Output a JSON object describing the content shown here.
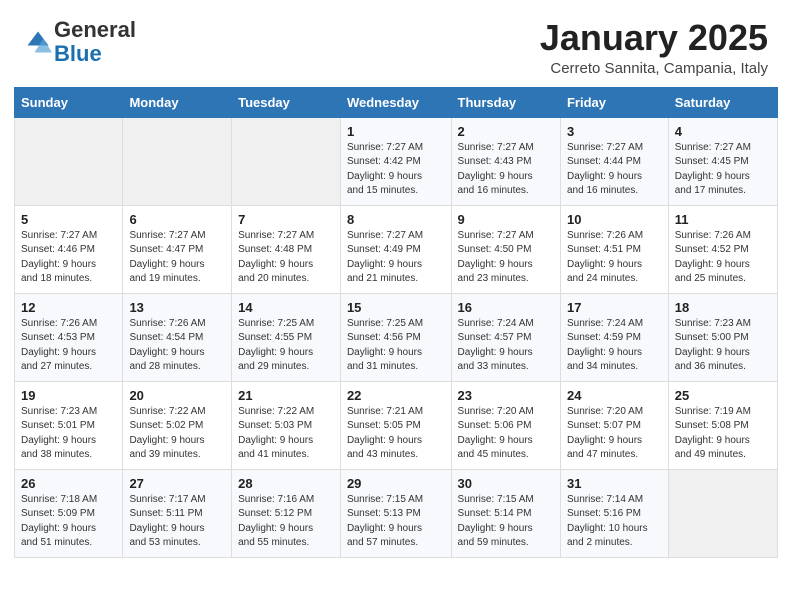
{
  "header": {
    "logo_general": "General",
    "logo_blue": "Blue",
    "month_title": "January 2025",
    "location": "Cerreto Sannita, Campania, Italy"
  },
  "weekdays": [
    "Sunday",
    "Monday",
    "Tuesday",
    "Wednesday",
    "Thursday",
    "Friday",
    "Saturday"
  ],
  "weeks": [
    [
      {
        "day": "",
        "info": ""
      },
      {
        "day": "",
        "info": ""
      },
      {
        "day": "",
        "info": ""
      },
      {
        "day": "1",
        "info": "Sunrise: 7:27 AM\nSunset: 4:42 PM\nDaylight: 9 hours\nand 15 minutes."
      },
      {
        "day": "2",
        "info": "Sunrise: 7:27 AM\nSunset: 4:43 PM\nDaylight: 9 hours\nand 16 minutes."
      },
      {
        "day": "3",
        "info": "Sunrise: 7:27 AM\nSunset: 4:44 PM\nDaylight: 9 hours\nand 16 minutes."
      },
      {
        "day": "4",
        "info": "Sunrise: 7:27 AM\nSunset: 4:45 PM\nDaylight: 9 hours\nand 17 minutes."
      }
    ],
    [
      {
        "day": "5",
        "info": "Sunrise: 7:27 AM\nSunset: 4:46 PM\nDaylight: 9 hours\nand 18 minutes."
      },
      {
        "day": "6",
        "info": "Sunrise: 7:27 AM\nSunset: 4:47 PM\nDaylight: 9 hours\nand 19 minutes."
      },
      {
        "day": "7",
        "info": "Sunrise: 7:27 AM\nSunset: 4:48 PM\nDaylight: 9 hours\nand 20 minutes."
      },
      {
        "day": "8",
        "info": "Sunrise: 7:27 AM\nSunset: 4:49 PM\nDaylight: 9 hours\nand 21 minutes."
      },
      {
        "day": "9",
        "info": "Sunrise: 7:27 AM\nSunset: 4:50 PM\nDaylight: 9 hours\nand 23 minutes."
      },
      {
        "day": "10",
        "info": "Sunrise: 7:26 AM\nSunset: 4:51 PM\nDaylight: 9 hours\nand 24 minutes."
      },
      {
        "day": "11",
        "info": "Sunrise: 7:26 AM\nSunset: 4:52 PM\nDaylight: 9 hours\nand 25 minutes."
      }
    ],
    [
      {
        "day": "12",
        "info": "Sunrise: 7:26 AM\nSunset: 4:53 PM\nDaylight: 9 hours\nand 27 minutes."
      },
      {
        "day": "13",
        "info": "Sunrise: 7:26 AM\nSunset: 4:54 PM\nDaylight: 9 hours\nand 28 minutes."
      },
      {
        "day": "14",
        "info": "Sunrise: 7:25 AM\nSunset: 4:55 PM\nDaylight: 9 hours\nand 29 minutes."
      },
      {
        "day": "15",
        "info": "Sunrise: 7:25 AM\nSunset: 4:56 PM\nDaylight: 9 hours\nand 31 minutes."
      },
      {
        "day": "16",
        "info": "Sunrise: 7:24 AM\nSunset: 4:57 PM\nDaylight: 9 hours\nand 33 minutes."
      },
      {
        "day": "17",
        "info": "Sunrise: 7:24 AM\nSunset: 4:59 PM\nDaylight: 9 hours\nand 34 minutes."
      },
      {
        "day": "18",
        "info": "Sunrise: 7:23 AM\nSunset: 5:00 PM\nDaylight: 9 hours\nand 36 minutes."
      }
    ],
    [
      {
        "day": "19",
        "info": "Sunrise: 7:23 AM\nSunset: 5:01 PM\nDaylight: 9 hours\nand 38 minutes."
      },
      {
        "day": "20",
        "info": "Sunrise: 7:22 AM\nSunset: 5:02 PM\nDaylight: 9 hours\nand 39 minutes."
      },
      {
        "day": "21",
        "info": "Sunrise: 7:22 AM\nSunset: 5:03 PM\nDaylight: 9 hours\nand 41 minutes."
      },
      {
        "day": "22",
        "info": "Sunrise: 7:21 AM\nSunset: 5:05 PM\nDaylight: 9 hours\nand 43 minutes."
      },
      {
        "day": "23",
        "info": "Sunrise: 7:20 AM\nSunset: 5:06 PM\nDaylight: 9 hours\nand 45 minutes."
      },
      {
        "day": "24",
        "info": "Sunrise: 7:20 AM\nSunset: 5:07 PM\nDaylight: 9 hours\nand 47 minutes."
      },
      {
        "day": "25",
        "info": "Sunrise: 7:19 AM\nSunset: 5:08 PM\nDaylight: 9 hours\nand 49 minutes."
      }
    ],
    [
      {
        "day": "26",
        "info": "Sunrise: 7:18 AM\nSunset: 5:09 PM\nDaylight: 9 hours\nand 51 minutes."
      },
      {
        "day": "27",
        "info": "Sunrise: 7:17 AM\nSunset: 5:11 PM\nDaylight: 9 hours\nand 53 minutes."
      },
      {
        "day": "28",
        "info": "Sunrise: 7:16 AM\nSunset: 5:12 PM\nDaylight: 9 hours\nand 55 minutes."
      },
      {
        "day": "29",
        "info": "Sunrise: 7:15 AM\nSunset: 5:13 PM\nDaylight: 9 hours\nand 57 minutes."
      },
      {
        "day": "30",
        "info": "Sunrise: 7:15 AM\nSunset: 5:14 PM\nDaylight: 9 hours\nand 59 minutes."
      },
      {
        "day": "31",
        "info": "Sunrise: 7:14 AM\nSunset: 5:16 PM\nDaylight: 10 hours\nand 2 minutes."
      },
      {
        "day": "",
        "info": ""
      }
    ]
  ]
}
